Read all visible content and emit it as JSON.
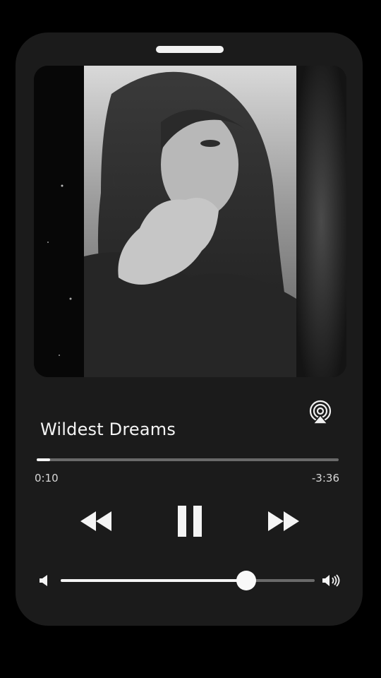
{
  "player": {
    "song_title": "Wildest Dreams",
    "time_elapsed": "0:10",
    "time_remaining": "-3:36",
    "progress_fraction": 0.045,
    "volume_fraction": 0.73
  },
  "icons": {
    "airplay": "airplay-icon",
    "rewind": "rewind-icon",
    "pause": "pause-icon",
    "fast_forward": "fast-forward-icon",
    "volume_low": "volume-low-icon",
    "volume_high": "volume-high-icon"
  },
  "colors": {
    "background": "#000000",
    "panel": "#1b1b1b",
    "foreground": "#f4f4f4",
    "track": "#6a6a6a"
  }
}
